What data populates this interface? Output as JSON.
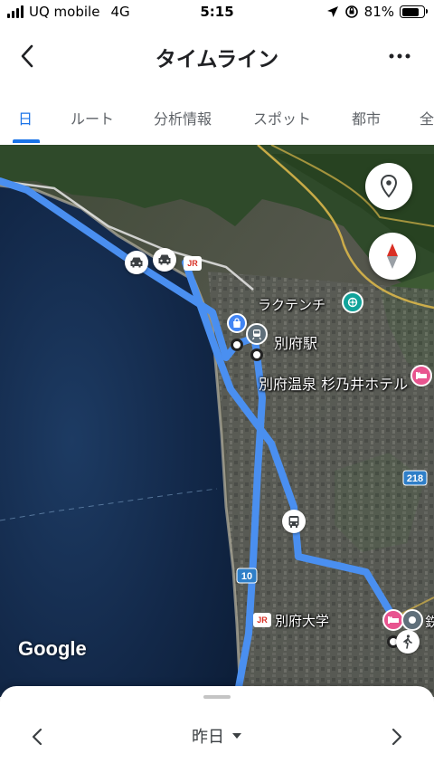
{
  "status_bar": {
    "carrier": "UQ mobile",
    "network": "4G",
    "time": "5:15",
    "battery_percent": "81%",
    "battery_level": 0.81
  },
  "header": {
    "title": "タイムライン"
  },
  "tabs": [
    {
      "label": "日",
      "active": true
    },
    {
      "label": "ルート",
      "active": false
    },
    {
      "label": "分析情報",
      "active": false
    },
    {
      "label": "スポット",
      "active": false
    },
    {
      "label": "都市",
      "active": false
    },
    {
      "label": "全",
      "active": false
    }
  ],
  "map": {
    "labels": {
      "raku_tenchi": "ラクテンチ",
      "beppu_station": "別府駅",
      "hotel": "別府温泉 杉乃井ホテル",
      "university": "別府大学",
      "edge_char": "鉄"
    },
    "route_shields": [
      "218",
      "10"
    ],
    "jr_badges": [
      "JR",
      "JR"
    ],
    "watermark": "Google",
    "route_color": "#4a8ff0",
    "icons": [
      "car-icon",
      "car-icon",
      "bus-icon",
      "shopping-icon",
      "walk-icon",
      "hotel-icon",
      "attraction-icon",
      "location-pin-icon",
      "compass-icon"
    ]
  },
  "bottom_sheet": {
    "day_label": "昨日"
  }
}
